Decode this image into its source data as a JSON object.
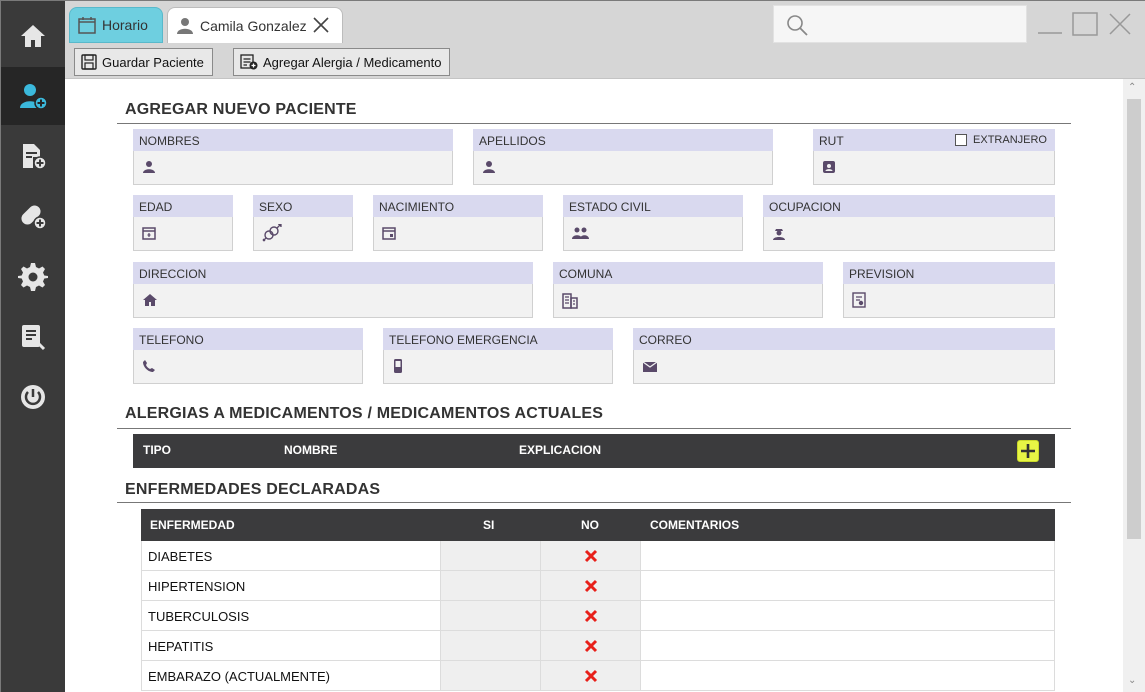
{
  "tabs": [
    {
      "label": "Horario",
      "icon": "calendar-icon"
    },
    {
      "label": "Camila Gonzalez",
      "icon": "user-icon"
    }
  ],
  "toolbar": {
    "save_label": "Guardar Paciente",
    "add_allergy_label": "Agregar Alergia / Medicamento"
  },
  "sidebar": {
    "items": [
      "home-icon",
      "add-patient-icon",
      "add-document-icon",
      "add-medication-icon",
      "settings-icon",
      "report-icon",
      "power-icon"
    ]
  },
  "form": {
    "title": "AGREGAR NUEVO PACIENTE",
    "nombres": "NOMBRES",
    "apellidos": "APELLIDOS",
    "rut": "RUT",
    "extranjero": "EXTRANJERO",
    "edad": "EDAD",
    "sexo": "SEXO",
    "nacimiento": "NACIMIENTO",
    "estado_civil": "ESTADO CIVIL",
    "ocupacion": "OCUPACION",
    "direccion": "DIRECCION",
    "comuna": "COMUNA",
    "prevision": "PREVISION",
    "telefono": "TELEFONO",
    "telefono_emergencia": "TELEFONO EMERGENCIA",
    "correo": "CORREO"
  },
  "allergies": {
    "title": "ALERGIAS A MEDICAMENTOS / MEDICAMENTOS ACTUALES",
    "col_tipo": "TIPO",
    "col_nombre": "NOMBRE",
    "col_explicacion": "EXPLICACION"
  },
  "diseases": {
    "title": "ENFERMEDADES DECLARADAS",
    "col_enfermedad": "ENFERMEDAD",
    "col_si": "SI",
    "col_no": "NO",
    "col_comentarios": "COMENTARIOS",
    "rows": [
      {
        "name": "DIABETES",
        "answer": "no"
      },
      {
        "name": "HIPERTENSION",
        "answer": "no"
      },
      {
        "name": "TUBERCULOSIS",
        "answer": "no"
      },
      {
        "name": "HEPATITIS",
        "answer": "no"
      },
      {
        "name": "EMBARAZO (ACTUALMENTE)",
        "answer": "no"
      }
    ]
  },
  "colors": {
    "sidebar_bg": "#3a3a3a",
    "accent_blue": "#3bb9dc",
    "tab_active": "#6ecfe0",
    "field_label_bg": "#d9d9ef",
    "icon_purple": "#5a4a6a",
    "add_button": "#e7f545",
    "cross_red": "#e8201a"
  }
}
